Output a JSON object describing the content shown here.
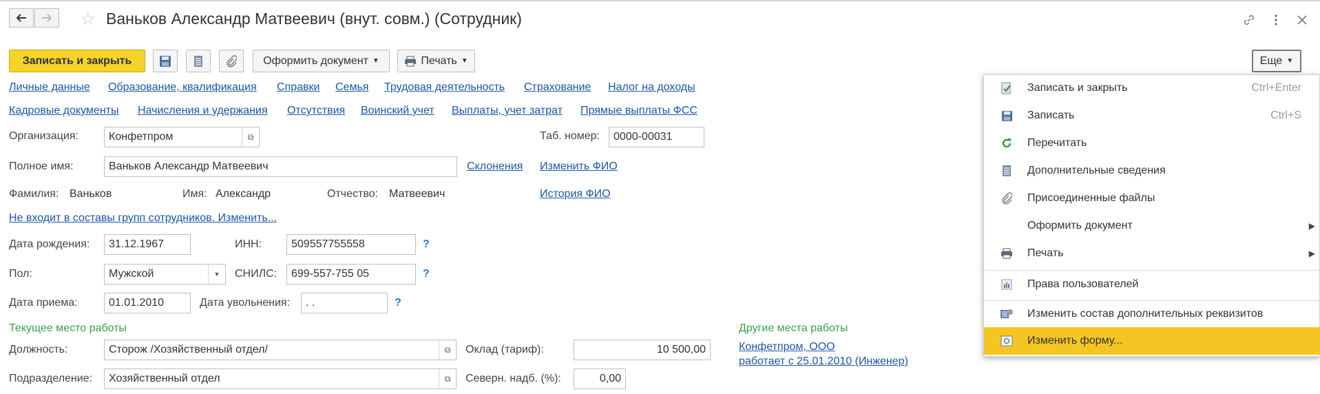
{
  "window": {
    "title": "Ваньков Александр Матвеевич (внут. совм.) (Сотрудник)"
  },
  "toolbar": {
    "save_close": "Записать и закрыть",
    "make_document": "Оформить документ",
    "print": "Печать",
    "more": "Еще"
  },
  "links_row1": [
    "Личные данные",
    "Образование, квалификация",
    "Справки",
    "Семья",
    "Трудовая деятельность",
    "Страхование",
    "Налог на доходы"
  ],
  "links_row2": [
    "Кадровые документы",
    "Начисления и удержания",
    "Отсутствия",
    "Воинский учет",
    "Выплаты, учет затрат",
    "Прямые выплаты ФСС"
  ],
  "form": {
    "org_label": "Организация:",
    "org_value": "Конфетпром",
    "tab_label": "Таб. номер:",
    "tab_value": "0000-00031",
    "fullname_label": "Полное имя:",
    "fullname_value": "Ваньков Александр Матвеевич",
    "declensions_link": "Склонения",
    "change_fio_link": "Изменить ФИО",
    "surname_label": "Фамилия:",
    "surname_value": "Ваньков",
    "name_label": "Имя:",
    "name_value": "Александр",
    "patronymic_label": "Отчество:",
    "patronymic_value": "Матвеевич",
    "history_fio_link": "История ФИО",
    "groups_link": "Не входит в составы групп сотрудников. Изменить...",
    "birth_label": "Дата рождения:",
    "birth_value": "31.12.1967",
    "inn_label": "ИНН:",
    "inn_value": "509557755558",
    "gender_label": "Пол:",
    "gender_value": "Мужской",
    "snils_label": "СНИЛС:",
    "snils_value": "699-557-755 05",
    "hire_label": "Дата приема:",
    "hire_value": "01.01.2010",
    "dismiss_label": "Дата увольнения:",
    "dismiss_value": " .  .",
    "help_mark": "?",
    "current_work_header": "Текущее место работы",
    "position_label": "Должность:",
    "position_value": "Сторож /Хозяйственный отдел/",
    "salary_label": "Оклад (тариф):",
    "salary_value": "10 500,00",
    "dept_label": "Подразделение:",
    "dept_value": "Хозяйственный отдел",
    "north_label": "Северн. надб. (%):",
    "north_value": "0,00",
    "other_work_header": "Другие места работы",
    "other_work_org": "Конфетпром, ООО",
    "other_work_detail": "работает с 25.01.2010 (Инженер)"
  },
  "menu": {
    "items": [
      {
        "label": "Записать и закрыть",
        "shortcut": "Ctrl+Enter",
        "icon": "save-close-icon"
      },
      {
        "label": "Записать",
        "shortcut": "Ctrl+S",
        "icon": "floppy-icon"
      },
      {
        "label": "Перечитать",
        "shortcut": "",
        "icon": "refresh-icon"
      },
      {
        "label": "Дополнительные сведения",
        "shortcut": "",
        "icon": "document-icon"
      },
      {
        "label": "Присоединенные файлы",
        "shortcut": "",
        "icon": "paperclip-icon"
      },
      {
        "label": "Оформить документ",
        "shortcut": "",
        "icon": ""
      },
      {
        "label": "Печать",
        "shortcut": "",
        "icon": "printer-icon"
      },
      {
        "label": "Права пользователей",
        "shortcut": "",
        "icon": "user-rights-icon"
      },
      {
        "label": "Изменить состав дополнительных реквизитов",
        "shortcut": "",
        "icon": "attributes-icon"
      },
      {
        "label": "Изменить форму...",
        "shortcut": "",
        "icon": "form-settings-icon"
      }
    ]
  },
  "colors": {
    "accent_yellow": "#f5d329",
    "highlight": "#f5c522",
    "link": "#1b56a6",
    "section_green": "#3aa04a"
  }
}
